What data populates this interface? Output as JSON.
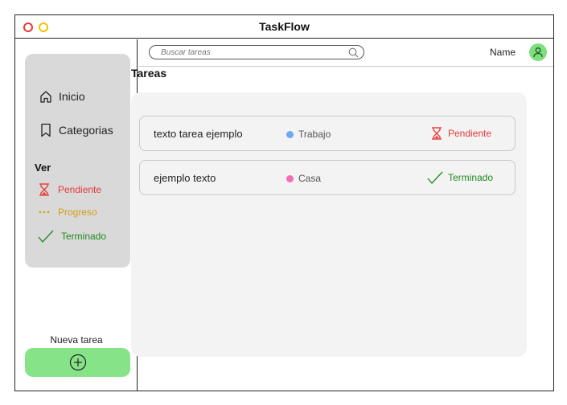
{
  "window": {
    "title": "TaskFlow"
  },
  "sidebar": {
    "nav": [
      {
        "label": "Inicio",
        "icon": "home-icon"
      },
      {
        "label": "Categorias",
        "icon": "bookmark-icon"
      }
    ],
    "ver_heading": "Ver",
    "filters": [
      {
        "label": "Pendiente",
        "icon": "hourglass-icon",
        "color": "#e53935"
      },
      {
        "label": "Progreso",
        "icon": "dots-icon",
        "color": "#d4a017"
      },
      {
        "label": "Terminado",
        "icon": "check-icon",
        "color": "#1e8a1e"
      }
    ],
    "new_task_label": "Nueva tarea",
    "new_task_button_icon": "plus-circle-icon"
  },
  "topbar": {
    "search_placeholder": "Buscar tareas",
    "user_name": "Name"
  },
  "main": {
    "title": "Tareas",
    "tasks": [
      {
        "text": "texto tarea ejemplo",
        "category": "Trabajo",
        "category_color": "#6fa8f0",
        "status": "Pendiente",
        "status_icon": "hourglass-icon"
      },
      {
        "text": "ejemplo texto",
        "category": "Casa",
        "category_color": "#f06fb4",
        "status": "Terminado",
        "status_icon": "check-icon"
      }
    ]
  },
  "colors": {
    "accent_green": "#86e387",
    "pending_red": "#e53935",
    "progress_yellow": "#d4a017",
    "done_green": "#1e8a1e"
  }
}
